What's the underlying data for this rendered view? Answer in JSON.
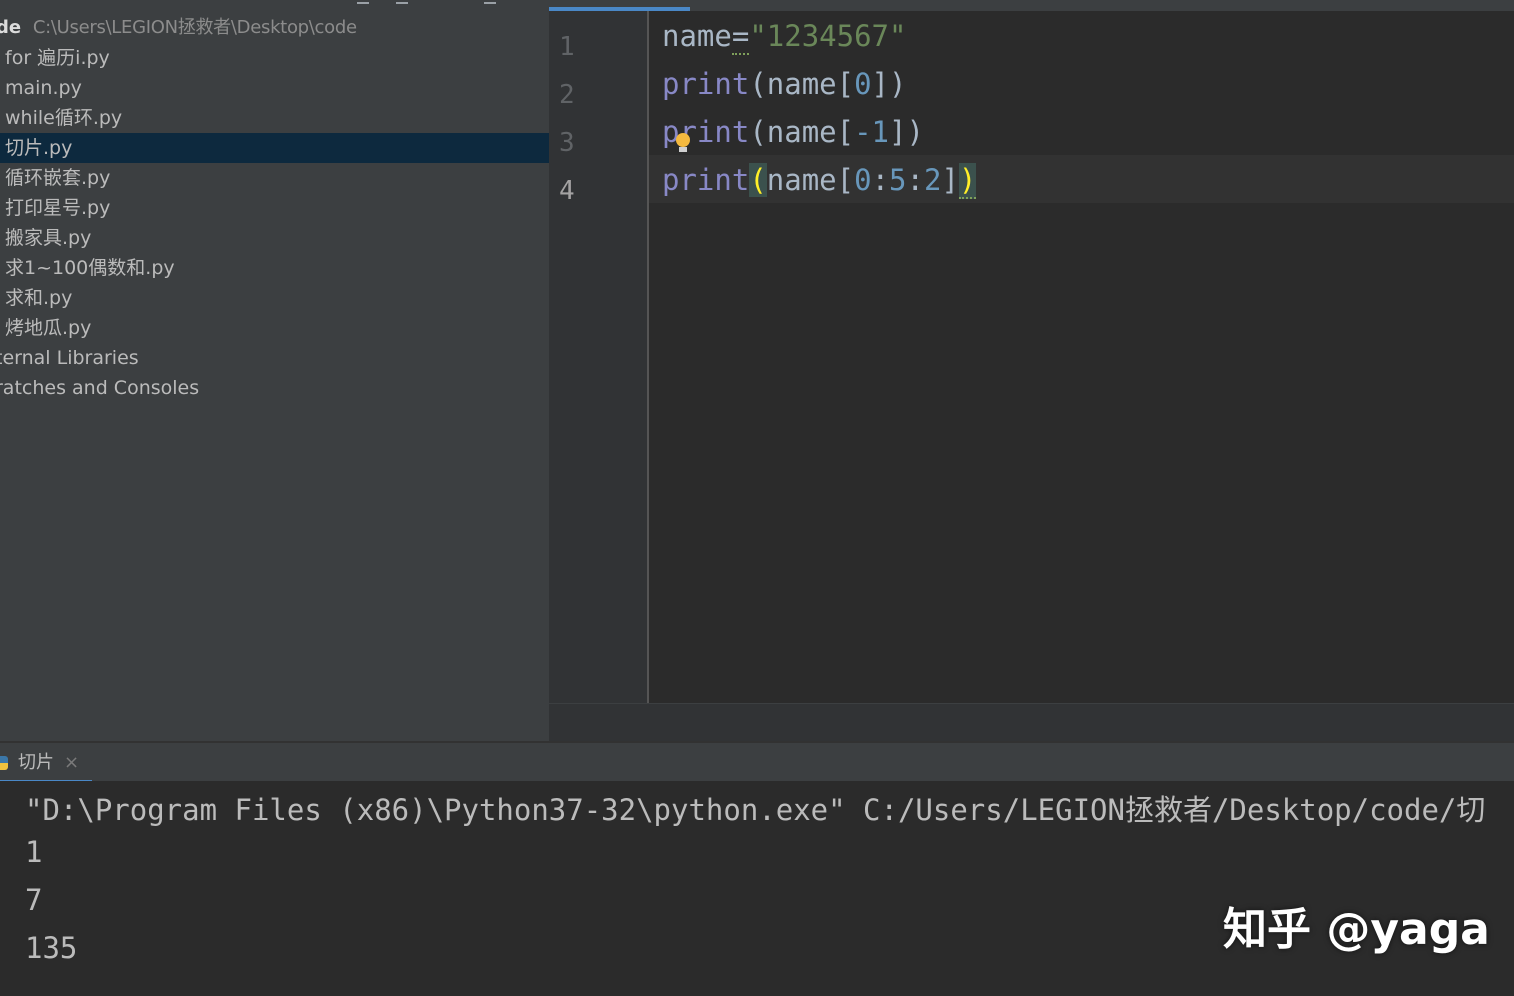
{
  "project": {
    "root_name": "de",
    "root_path": "C:\\Users\\LEGION拯救者\\Desktop\\code",
    "files": [
      {
        "label": "for 遍历i.py",
        "selected": false
      },
      {
        "label": "main.py",
        "selected": false
      },
      {
        "label": "while循环.py",
        "selected": false
      },
      {
        "label": "切片.py",
        "selected": true
      },
      {
        "label": "循环嵌套.py",
        "selected": false
      },
      {
        "label": "打印星号.py",
        "selected": false
      },
      {
        "label": "搬家具.py",
        "selected": false
      },
      {
        "label": "求1~100偶数和.py",
        "selected": false
      },
      {
        "label": "求和.py",
        "selected": false
      },
      {
        "label": "烤地瓜.py",
        "selected": false
      }
    ],
    "external": "ternal Libraries",
    "scratches": "ratches and Consoles"
  },
  "editor": {
    "line_numbers": [
      "1",
      "2",
      "3",
      "4"
    ],
    "current_line": 4,
    "lines": [
      "name=\"1234567\"",
      "print(name[0])",
      "print(name[-1])",
      "print(name[0:5:2])"
    ]
  },
  "run": {
    "tab_label": "切片",
    "close_glyph": "×",
    "console_lines": [
      "\"D:\\Program Files (x86)\\Python37-32\\python.exe\" C:/Users/LEGION拯救者/Desktop/code/切",
      "1",
      "7",
      "135"
    ]
  },
  "watermark": "知乎 @yaga",
  "colors": {
    "selection": "#0d293e",
    "builtin": "#8888c6",
    "string": "#6a8759",
    "number": "#6897bb",
    "bracket_match": "#ffef28",
    "accent": "#4a88c7"
  }
}
